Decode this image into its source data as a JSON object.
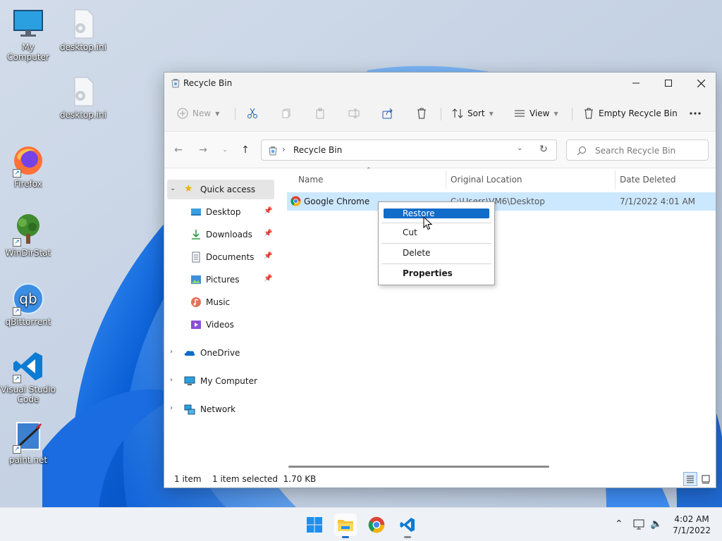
{
  "desktop": {
    "icons": [
      {
        "label": "My Computer",
        "icon": "monitor-icon"
      },
      {
        "label": "desktop.ini",
        "icon": "settings-file-icon"
      },
      {
        "label": "desktop.ini",
        "icon": "settings-file-icon"
      },
      {
        "label": "Firefox",
        "icon": "firefox-icon"
      },
      {
        "label": "WinDirStat",
        "icon": "windirstat-icon"
      },
      {
        "label": "qBittorrent",
        "icon": "qbittorrent-icon"
      },
      {
        "label": "Visual Studio Code",
        "icon": "vscode-icon"
      },
      {
        "label": "paint.net",
        "icon": "paintnet-icon"
      }
    ]
  },
  "window": {
    "title": "Recycle Bin",
    "toolbar": {
      "new": "New",
      "sort": "Sort",
      "view": "View",
      "empty": "Empty Recycle Bin"
    },
    "address": {
      "path": "Recycle Bin",
      "search_placeholder": "Search Recycle Bin"
    },
    "nav": {
      "quick_access": "Quick access",
      "items": [
        "Desktop",
        "Downloads",
        "Documents",
        "Pictures",
        "Music",
        "Videos"
      ],
      "onedrive": "OneDrive",
      "my_computer": "My Computer",
      "network": "Network"
    },
    "columns": {
      "name": "Name",
      "location": "Original Location",
      "date": "Date Deleted"
    },
    "rows": [
      {
        "name": "Google Chrome",
        "location": "C:\\Users\\VM6\\Desktop",
        "date": "7/1/2022 4:01 AM"
      }
    ],
    "status": {
      "count": "1 item",
      "selected": "1 item selected  1.70 KB"
    }
  },
  "context_menu": {
    "items": [
      "Restore",
      "Cut",
      "Delete",
      "Properties"
    ]
  },
  "taskbar": {
    "time": "4:02 AM",
    "date": "7/1/2022"
  },
  "colors": {
    "accent": "#0f6cc9",
    "selection": "#cce8ff",
    "wallpaper": "#c9d6e6"
  }
}
